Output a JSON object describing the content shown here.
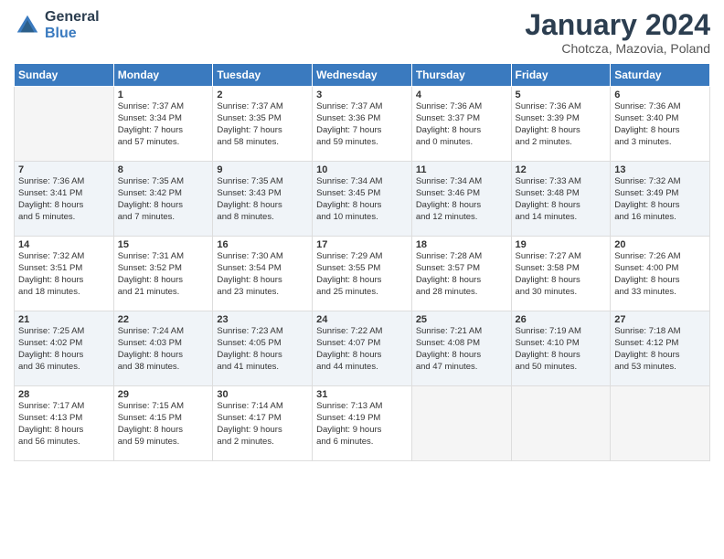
{
  "header": {
    "logo_line1": "General",
    "logo_line2": "Blue",
    "month": "January 2024",
    "location": "Chotcza, Mazovia, Poland"
  },
  "days_of_week": [
    "Sunday",
    "Monday",
    "Tuesday",
    "Wednesday",
    "Thursday",
    "Friday",
    "Saturday"
  ],
  "weeks": [
    [
      {
        "day": "",
        "info": ""
      },
      {
        "day": "1",
        "info": "Sunrise: 7:37 AM\nSunset: 3:34 PM\nDaylight: 7 hours\nand 57 minutes."
      },
      {
        "day": "2",
        "info": "Sunrise: 7:37 AM\nSunset: 3:35 PM\nDaylight: 7 hours\nand 58 minutes."
      },
      {
        "day": "3",
        "info": "Sunrise: 7:37 AM\nSunset: 3:36 PM\nDaylight: 7 hours\nand 59 minutes."
      },
      {
        "day": "4",
        "info": "Sunrise: 7:36 AM\nSunset: 3:37 PM\nDaylight: 8 hours\nand 0 minutes."
      },
      {
        "day": "5",
        "info": "Sunrise: 7:36 AM\nSunset: 3:39 PM\nDaylight: 8 hours\nand 2 minutes."
      },
      {
        "day": "6",
        "info": "Sunrise: 7:36 AM\nSunset: 3:40 PM\nDaylight: 8 hours\nand 3 minutes."
      }
    ],
    [
      {
        "day": "7",
        "info": "Sunrise: 7:36 AM\nSunset: 3:41 PM\nDaylight: 8 hours\nand 5 minutes."
      },
      {
        "day": "8",
        "info": "Sunrise: 7:35 AM\nSunset: 3:42 PM\nDaylight: 8 hours\nand 7 minutes."
      },
      {
        "day": "9",
        "info": "Sunrise: 7:35 AM\nSunset: 3:43 PM\nDaylight: 8 hours\nand 8 minutes."
      },
      {
        "day": "10",
        "info": "Sunrise: 7:34 AM\nSunset: 3:45 PM\nDaylight: 8 hours\nand 10 minutes."
      },
      {
        "day": "11",
        "info": "Sunrise: 7:34 AM\nSunset: 3:46 PM\nDaylight: 8 hours\nand 12 minutes."
      },
      {
        "day": "12",
        "info": "Sunrise: 7:33 AM\nSunset: 3:48 PM\nDaylight: 8 hours\nand 14 minutes."
      },
      {
        "day": "13",
        "info": "Sunrise: 7:32 AM\nSunset: 3:49 PM\nDaylight: 8 hours\nand 16 minutes."
      }
    ],
    [
      {
        "day": "14",
        "info": "Sunrise: 7:32 AM\nSunset: 3:51 PM\nDaylight: 8 hours\nand 18 minutes."
      },
      {
        "day": "15",
        "info": "Sunrise: 7:31 AM\nSunset: 3:52 PM\nDaylight: 8 hours\nand 21 minutes."
      },
      {
        "day": "16",
        "info": "Sunrise: 7:30 AM\nSunset: 3:54 PM\nDaylight: 8 hours\nand 23 minutes."
      },
      {
        "day": "17",
        "info": "Sunrise: 7:29 AM\nSunset: 3:55 PM\nDaylight: 8 hours\nand 25 minutes."
      },
      {
        "day": "18",
        "info": "Sunrise: 7:28 AM\nSunset: 3:57 PM\nDaylight: 8 hours\nand 28 minutes."
      },
      {
        "day": "19",
        "info": "Sunrise: 7:27 AM\nSunset: 3:58 PM\nDaylight: 8 hours\nand 30 minutes."
      },
      {
        "day": "20",
        "info": "Sunrise: 7:26 AM\nSunset: 4:00 PM\nDaylight: 8 hours\nand 33 minutes."
      }
    ],
    [
      {
        "day": "21",
        "info": "Sunrise: 7:25 AM\nSunset: 4:02 PM\nDaylight: 8 hours\nand 36 minutes."
      },
      {
        "day": "22",
        "info": "Sunrise: 7:24 AM\nSunset: 4:03 PM\nDaylight: 8 hours\nand 38 minutes."
      },
      {
        "day": "23",
        "info": "Sunrise: 7:23 AM\nSunset: 4:05 PM\nDaylight: 8 hours\nand 41 minutes."
      },
      {
        "day": "24",
        "info": "Sunrise: 7:22 AM\nSunset: 4:07 PM\nDaylight: 8 hours\nand 44 minutes."
      },
      {
        "day": "25",
        "info": "Sunrise: 7:21 AM\nSunset: 4:08 PM\nDaylight: 8 hours\nand 47 minutes."
      },
      {
        "day": "26",
        "info": "Sunrise: 7:19 AM\nSunset: 4:10 PM\nDaylight: 8 hours\nand 50 minutes."
      },
      {
        "day": "27",
        "info": "Sunrise: 7:18 AM\nSunset: 4:12 PM\nDaylight: 8 hours\nand 53 minutes."
      }
    ],
    [
      {
        "day": "28",
        "info": "Sunrise: 7:17 AM\nSunset: 4:13 PM\nDaylight: 8 hours\nand 56 minutes."
      },
      {
        "day": "29",
        "info": "Sunrise: 7:15 AM\nSunset: 4:15 PM\nDaylight: 8 hours\nand 59 minutes."
      },
      {
        "day": "30",
        "info": "Sunrise: 7:14 AM\nSunset: 4:17 PM\nDaylight: 9 hours\nand 2 minutes."
      },
      {
        "day": "31",
        "info": "Sunrise: 7:13 AM\nSunset: 4:19 PM\nDaylight: 9 hours\nand 6 minutes."
      },
      {
        "day": "",
        "info": ""
      },
      {
        "day": "",
        "info": ""
      },
      {
        "day": "",
        "info": ""
      }
    ]
  ]
}
